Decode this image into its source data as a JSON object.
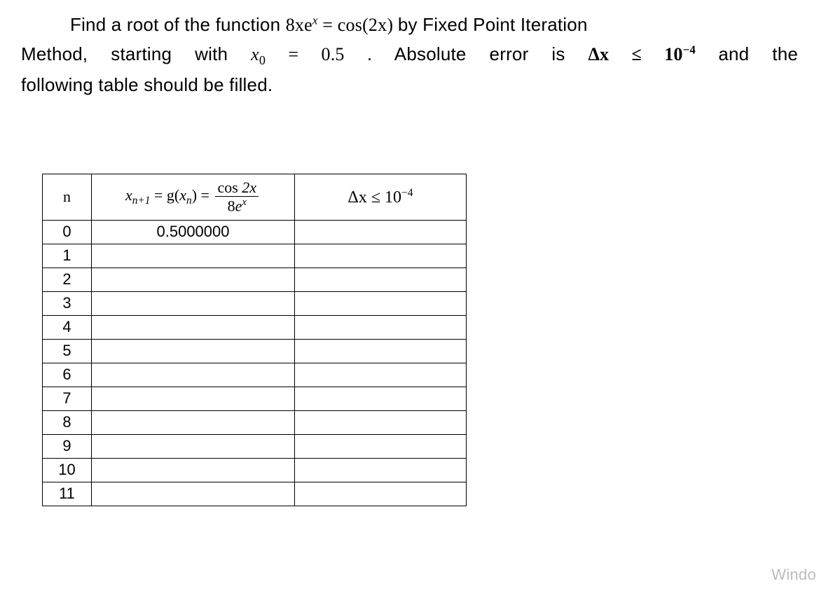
{
  "problem": {
    "intro_a": "Find a root of the function ",
    "eq_lhs": "8xe",
    "eq_lhs_sup": "x",
    "eq_eq": " = ",
    "eq_rhs_fn": "cos",
    "eq_rhs_arg": "(2x)",
    "intro_b": " by Fixed Point Iteration",
    "line2_a": "Method, starting with ",
    "x0_sym": "x",
    "x0_sub": "0",
    "x0_eq": " = 0.5",
    "line2_b": ". Absolute error is ",
    "dx_sym": "Δx",
    "dx_le": " ≤ 10",
    "dx_exp": "−4",
    "line2_c": " and the",
    "line3": "following table should be filled."
  },
  "table": {
    "header_n": "n",
    "header_g_lhs_x": "x",
    "header_g_lhs_sub": "n+1",
    "header_g_eq": " = g(",
    "header_g_lhs2_x": "x",
    "header_g_lhs2_sub": "n",
    "header_g_close": ") = ",
    "header_g_num_fn": "cos",
    "header_g_num_arg": " 2x",
    "header_g_den_coef": "8",
    "header_g_den_e": "e",
    "header_g_den_exp": "x",
    "header_err_dx": "Δx",
    "header_err_le": " ≤ 10",
    "header_err_exp": "−4",
    "rows": [
      {
        "n": "0",
        "g": "0.5000000",
        "err": ""
      },
      {
        "n": "1",
        "g": "",
        "err": ""
      },
      {
        "n": "2",
        "g": "",
        "err": ""
      },
      {
        "n": "3",
        "g": "",
        "err": ""
      },
      {
        "n": "4",
        "g": "",
        "err": ""
      },
      {
        "n": "5",
        "g": "",
        "err": ""
      },
      {
        "n": "6",
        "g": "",
        "err": ""
      },
      {
        "n": "7",
        "g": "",
        "err": ""
      },
      {
        "n": "8",
        "g": "",
        "err": ""
      },
      {
        "n": "9",
        "g": "",
        "err": ""
      },
      {
        "n": "10",
        "g": "",
        "err": ""
      },
      {
        "n": "11",
        "g": "",
        "err": ""
      }
    ]
  },
  "chart_data": {
    "type": "table",
    "columns": [
      "n",
      "x_{n+1} = g(x_n) = cos(2x)/(8e^x)",
      "Δx ≤ 10^-4"
    ],
    "rows": [
      [
        0,
        0.5,
        null
      ],
      [
        1,
        null,
        null
      ],
      [
        2,
        null,
        null
      ],
      [
        3,
        null,
        null
      ],
      [
        4,
        null,
        null
      ],
      [
        5,
        null,
        null
      ],
      [
        6,
        null,
        null
      ],
      [
        7,
        null,
        null
      ],
      [
        8,
        null,
        null
      ],
      [
        9,
        null,
        null
      ],
      [
        10,
        null,
        null
      ],
      [
        11,
        null,
        null
      ]
    ]
  },
  "watermark": "Windo"
}
